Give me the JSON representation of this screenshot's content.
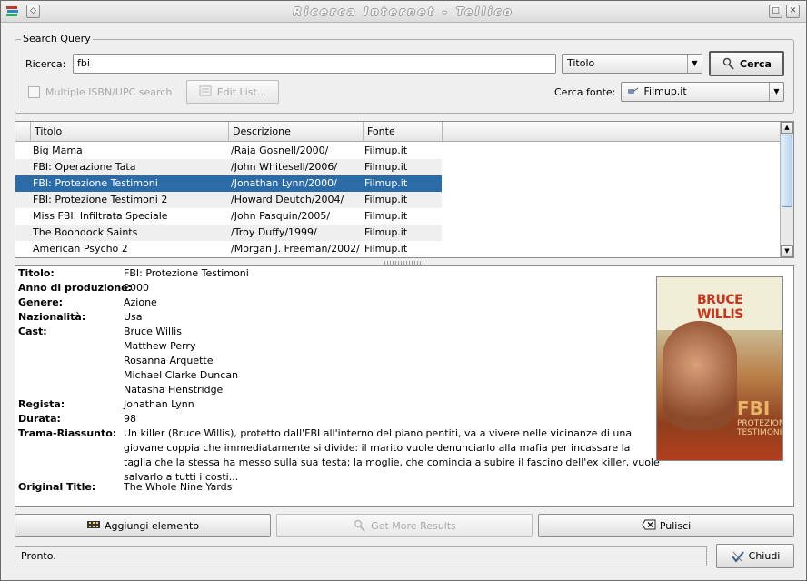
{
  "window": {
    "title": "Ricerca Internet - Tellico"
  },
  "search": {
    "group_title": "Search Query",
    "search_label": "Ricerca:",
    "search_value": "fbi",
    "field_select": "Titolo",
    "search_button": "Cerca",
    "multiple_label": "Multiple ISBN/UPC search",
    "edit_list_button": "Edit List...",
    "source_label": "Cerca fonte:",
    "source_select": "Filmup.it"
  },
  "results": {
    "columns": [
      "Titolo",
      "Descrizione",
      "Fonte"
    ],
    "rows": [
      {
        "title": "Big Mama",
        "desc": "/Raja Gosnell/2000/",
        "source": "Filmup.it"
      },
      {
        "title": "FBI: Operazione Tata",
        "desc": "/John Whitesell/2006/",
        "source": "Filmup.it"
      },
      {
        "title": "FBI: Protezione Testimoni",
        "desc": "/Jonathan Lynn/2000/",
        "source": "Filmup.it"
      },
      {
        "title": "FBI: Protezione Testimoni 2",
        "desc": "/Howard Deutch/2004/",
        "source": "Filmup.it"
      },
      {
        "title": "Miss FBI: Infiltrata Speciale",
        "desc": "/John Pasquin/2005/",
        "source": "Filmup.it"
      },
      {
        "title": "The Boondock Saints",
        "desc": "/Troy Duffy/1999/",
        "source": "Filmup.it"
      },
      {
        "title": "American Psycho 2",
        "desc": "/Morgan J. Freeman/2002/",
        "source": "Filmup.it"
      }
    ],
    "selected_index": 2
  },
  "details": {
    "title_label": "Titolo:",
    "title": "FBI: Protezione Testimoni",
    "year_label": "Anno di produzione:",
    "year": "2000",
    "genre_label": "Genere:",
    "genre": "Azione",
    "nationality_label": "Nazionalità:",
    "nationality": "Usa",
    "cast_label": "Cast:",
    "cast": [
      "Bruce Willis",
      "Matthew Perry",
      "Rosanna Arquette",
      "Michael Clarke Duncan",
      "Natasha Henstridge"
    ],
    "director_label": "Regista:",
    "director": "Jonathan Lynn",
    "duration_label": "Durata:",
    "duration": "98",
    "plot_label": "Trama-Riassunto:",
    "plot": "Un killer (Bruce Willis), protetto dall'FBI all'interno del piano pentiti, va a vivere nelle vicinanze di una giovane coppia che immediatamente si divide: il marito vuole denunciarlo alla mafia per incassare la taglia che la stessa ha messo sulla sua testa; la moglie, che comincia a subire il fascino dell'ex killer, vuole salvarlo a tutti i costi...",
    "original_title_label": "Original Title:",
    "original_title": "The Whole Nine Yards",
    "poster": {
      "actor": "BRUCE WILLIS",
      "film": "FBI",
      "subtitle": "PROTEZIONE TESTIMONI"
    }
  },
  "actions": {
    "add_button": "Aggiungi elemento",
    "more_button": "Get More Results",
    "clear_button": "Pulisci",
    "close_button": "Chiudi"
  },
  "status": {
    "text": "Pronto."
  }
}
